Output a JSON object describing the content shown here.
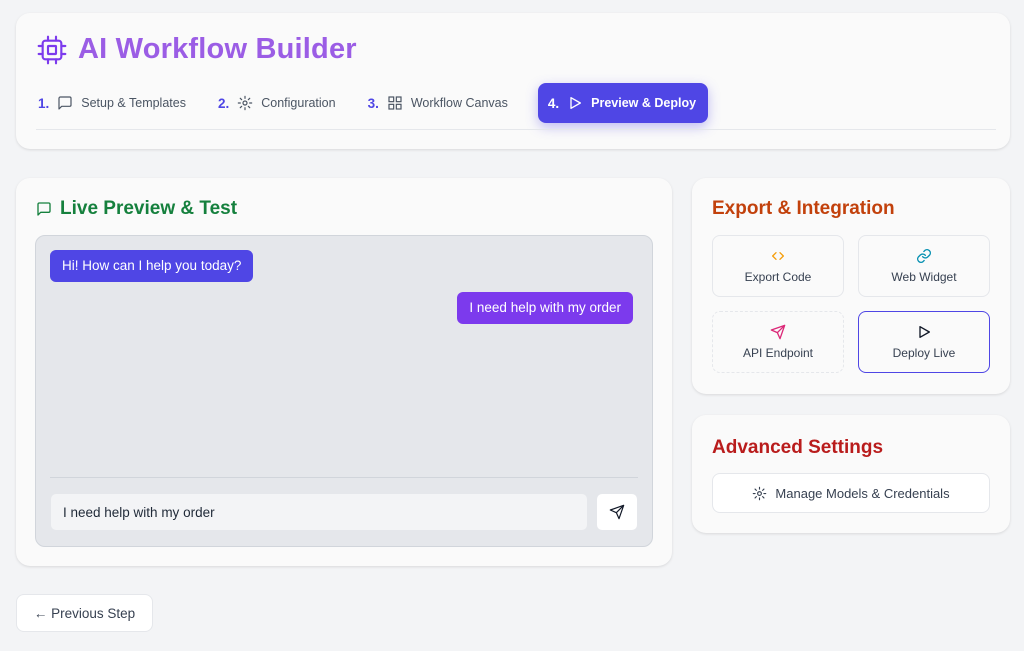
{
  "header": {
    "title": "AI Workflow Builder",
    "steps": [
      {
        "num": "1.",
        "label": "Setup & Templates"
      },
      {
        "num": "2.",
        "label": "Configuration"
      },
      {
        "num": "3.",
        "label": "Workflow Canvas"
      },
      {
        "num": "4.",
        "label": "Preview & Deploy",
        "active": true
      }
    ]
  },
  "preview": {
    "title": "Live Preview & Test",
    "messages": [
      {
        "role": "bot",
        "text": "Hi! How can I help you today?"
      },
      {
        "role": "user",
        "text": "I need help with my order"
      }
    ],
    "input_value": "I need help with my order"
  },
  "export": {
    "title": "Export & Integration",
    "tiles": [
      {
        "label": "Export Code",
        "icon": "code-icon",
        "icon_color": "#f59e0b"
      },
      {
        "label": "Web Widget",
        "icon": "link-icon",
        "icon_color": "#0891b2"
      },
      {
        "label": "API Endpoint",
        "icon": "send-icon",
        "icon_color": "#db2777"
      },
      {
        "label": "Deploy Live",
        "icon": "play-icon",
        "icon_color": "#111827"
      }
    ]
  },
  "advanced": {
    "title": "Advanced Settings",
    "manage_label": "Manage Models & Credentials"
  },
  "nav": {
    "previous_label": "← Previous Step"
  },
  "colors": {
    "title_purple": "#9b5de5",
    "accent_indigo": "#4f46e5",
    "green": "#15803d",
    "orange": "#c2410c",
    "red": "#b91c1c"
  }
}
